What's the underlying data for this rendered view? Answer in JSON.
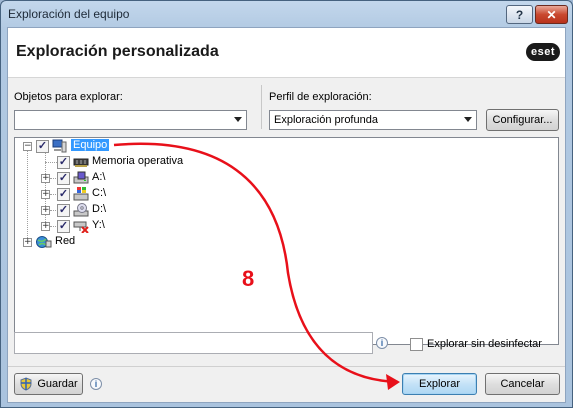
{
  "window": {
    "title": "Exploración del equipo",
    "help_glyph": "?",
    "close_glyph": "✕"
  },
  "header": {
    "title": "Exploración personalizada",
    "logo": "eset"
  },
  "targets": {
    "label": "Objetos para explorar:",
    "value": ""
  },
  "profile": {
    "label": "Perfil de exploración:",
    "value": "Exploración profunda",
    "configure_label": "Configurar..."
  },
  "tree": {
    "items": [
      {
        "label": "Equipo",
        "icon": "computer-icon",
        "checked": true,
        "selected": true
      },
      {
        "label": "Memoria operativa",
        "icon": "memory-chip-icon",
        "checked": true
      },
      {
        "label": "A:\\",
        "icon": "floppy-drive-icon",
        "checked": true
      },
      {
        "label": "C:\\",
        "icon": "windows-drive-icon",
        "checked": true
      },
      {
        "label": "D:\\",
        "icon": "cd-drive-icon",
        "checked": true
      },
      {
        "label": "Y:\\",
        "icon": "network-drive-disconnected-icon",
        "checked": true
      },
      {
        "label": "Red",
        "icon": "network-globe-icon",
        "checked": false
      }
    ],
    "check_glyph": "✓",
    "collapse_glyph": "−",
    "expand_glyph": "+"
  },
  "path_input": {
    "value": ""
  },
  "no_clean": {
    "label": "Explorar sin desinfectar",
    "checked": false
  },
  "footer": {
    "save_label": "Guardar",
    "scan_label": "Explorar",
    "cancel_label": "Cancelar",
    "info_glyph": "i"
  },
  "annotation": {
    "number": "8",
    "color": "#e8101a"
  }
}
